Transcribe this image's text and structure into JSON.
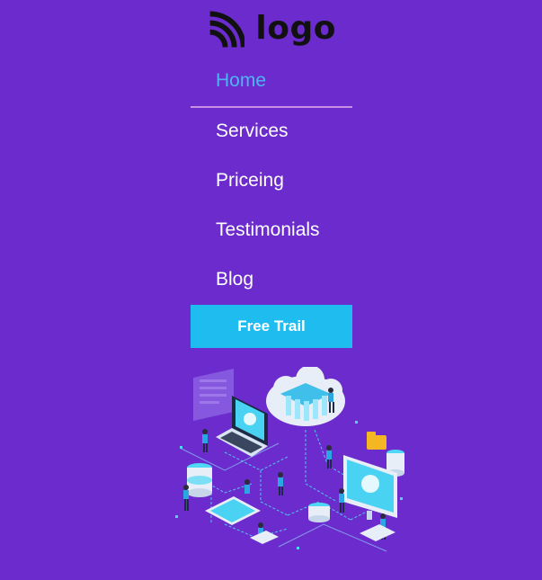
{
  "brand": {
    "logo_text": "logo",
    "logo_icon": "rss-wave-icon"
  },
  "nav": {
    "items": [
      {
        "label": "Home",
        "active": true
      },
      {
        "label": "Services",
        "active": false
      },
      {
        "label": "Priceing",
        "active": false
      },
      {
        "label": "Testimonials",
        "active": false
      },
      {
        "label": "Blog",
        "active": false
      }
    ]
  },
  "cta": {
    "label": "Free Trail"
  },
  "hero": {
    "illustration": "isometric-cloud-network-illustration"
  },
  "colors": {
    "background": "#6c2bcc",
    "active_link": "#4fb3f4",
    "active_underline": "#c98fe6",
    "cta_background": "#1fbdef",
    "text": "#ffffff"
  }
}
